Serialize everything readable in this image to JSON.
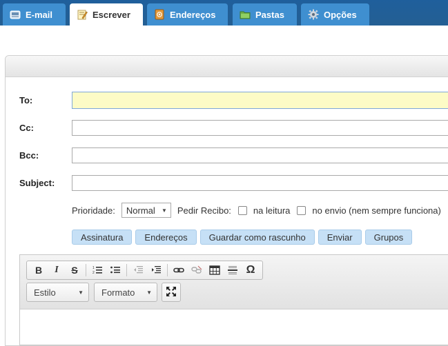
{
  "tabs": [
    {
      "label": "E-mail",
      "icon": "mail-icon",
      "active": false
    },
    {
      "label": "Escrever",
      "icon": "compose-icon",
      "active": true
    },
    {
      "label": "Endereços",
      "icon": "address-book-icon",
      "active": false
    },
    {
      "label": "Pastas",
      "icon": "folder-icon",
      "active": false
    },
    {
      "label": "Opções",
      "icon": "gear-icon",
      "active": false
    }
  ],
  "form": {
    "to_label": "To:",
    "cc_label": "Cc:",
    "bcc_label": "Bcc:",
    "subject_label": "Subject:",
    "to_value": "",
    "cc_value": "",
    "bcc_value": "",
    "subject_value": ""
  },
  "options": {
    "priority_label": "Prioridade:",
    "priority_value": "Normal",
    "receipt_label": "Pedir Recibo:",
    "on_read_label": "na leitura",
    "on_send_label": "no envio (nem sempre funciona)",
    "on_read_checked": false,
    "on_send_checked": false
  },
  "buttons": {
    "signature": "Assinatura",
    "addresses": "Endereços",
    "save_draft": "Guardar como rascunho",
    "send": "Enviar",
    "groups": "Grupos"
  },
  "editor": {
    "style_label": "Estilo",
    "format_label": "Formato",
    "bold": "B",
    "italic": "I",
    "strike": "S",
    "special_char": "Ω"
  },
  "colors": {
    "tabbar": "#245f93",
    "tab": "#3f8fd0",
    "button": "#c6e0f6",
    "focus_field": "#fdfbc6"
  }
}
